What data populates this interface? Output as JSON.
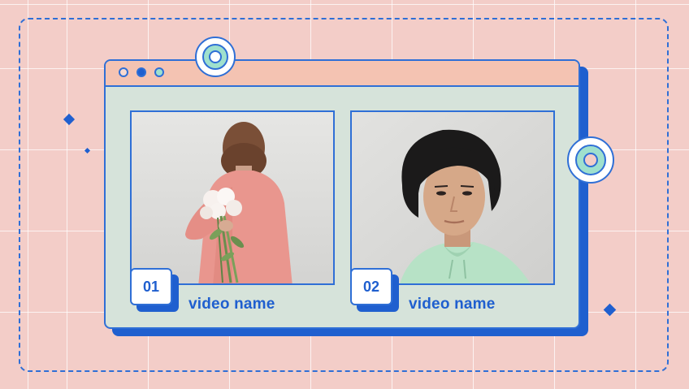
{
  "colors": {
    "background": "#f3cdc8",
    "accent_blue": "#1f5fcf",
    "panel_green": "#d6e3da",
    "titlebar_peach": "#f4c3b2",
    "mint": "#9fe0cd"
  },
  "window": {
    "controls": [
      {
        "icon": "circle-outline-icon"
      },
      {
        "icon": "circle-filled-icon"
      },
      {
        "icon": "circle-mint-icon"
      }
    ]
  },
  "videos": [
    {
      "number": "01",
      "name": "video name",
      "image": "woman-pink-coat-holding-flowers-image"
    },
    {
      "number": "02",
      "name": "video name",
      "image": "man-mint-hoodie-portrait-image"
    }
  ]
}
